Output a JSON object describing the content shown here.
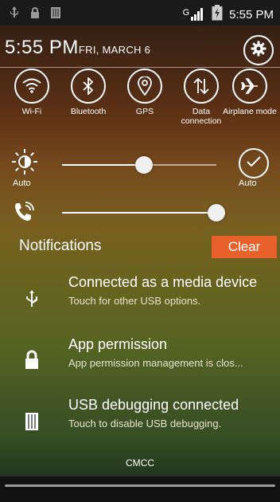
{
  "status_bar": {
    "signal_label": "G",
    "time": "5:55 PM"
  },
  "header": {
    "time": "5:55",
    "ampm": "PM",
    "date": "FRI, MARCH 6"
  },
  "quick_settings": [
    {
      "label": "Wi-Fi",
      "icon": "wifi-icon"
    },
    {
      "label": "Bluetooth",
      "icon": "bluetooth-icon"
    },
    {
      "label": "GPS",
      "icon": "gps-icon"
    },
    {
      "label": "Data connection",
      "icon": "data-connection-icon"
    },
    {
      "label": "Airplane mode",
      "icon": "airplane-icon"
    }
  ],
  "brightness": {
    "auto_left": "Auto",
    "auto_right": "Auto",
    "level": 0.53
  },
  "volume": {
    "level": 1.0
  },
  "notifications": {
    "title": "Notifications",
    "clear_label": "Clear",
    "items": [
      {
        "icon": "usb-icon",
        "title": "Connected as a media device",
        "subtitle": "Touch for other USB options."
      },
      {
        "icon": "lock-icon",
        "title": "App permission",
        "subtitle": "App permission management is clos..."
      },
      {
        "icon": "usb-debug-icon",
        "title": "USB debugging connected",
        "subtitle": "Touch to disable USB debugging."
      }
    ]
  },
  "carrier": "CMCC",
  "colors": {
    "accent": "#e8612c",
    "statusbar": "#1a1a1a"
  }
}
